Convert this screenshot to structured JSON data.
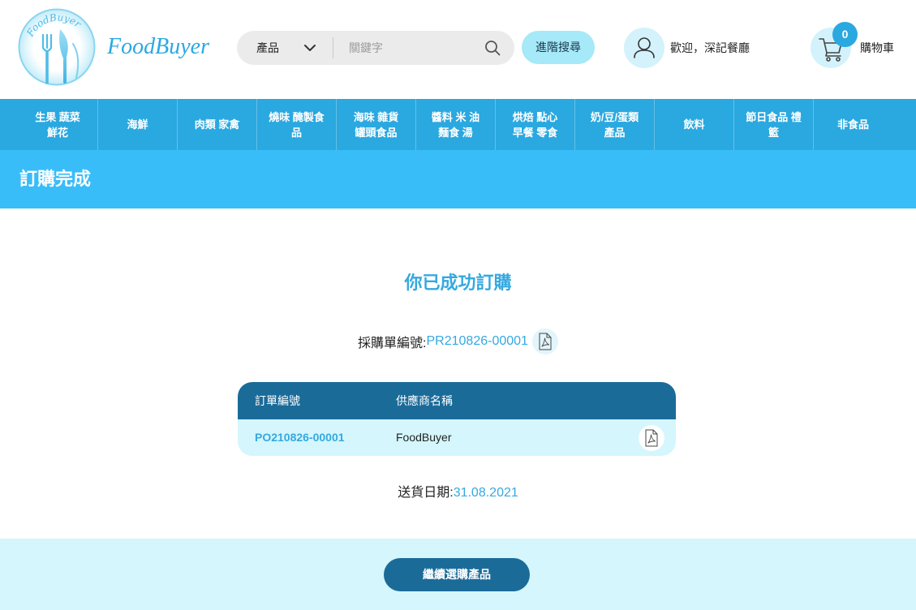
{
  "colors": {
    "nav_bg": "#2aa8e0",
    "banner_bg": "#38bdf8",
    "accent": "#35a9e0",
    "dark": "#1b6b99",
    "light": "#d4f6fc",
    "icon_bg": "#d3f2fb",
    "advanced_bg": "#a6e9f8"
  },
  "icons": {
    "logo": "fork-knife-logo-icon",
    "category_dropdown": "chevron-down-icon",
    "search": "search-icon",
    "user": "user-icon",
    "cart": "cart-icon",
    "document": "pdf-icon"
  },
  "header": {
    "logo": {
      "badge_text": "FoodBuyer",
      "wordmark": "FoodBuyer"
    },
    "search": {
      "category_selected": "產品",
      "placeholder": "關鍵字",
      "advanced_label": "進階搜尋"
    },
    "user": {
      "greeting": "歡迎，深記餐廳"
    },
    "cart": {
      "count": "0",
      "label": "購物車"
    }
  },
  "nav": {
    "items": [
      {
        "lines": [
          "生果 蔬菜",
          "鮮花"
        ]
      },
      {
        "lines": [
          "海鮮"
        ]
      },
      {
        "lines": [
          "肉類 家禽"
        ]
      },
      {
        "lines": [
          "燒味 醃製食",
          "品"
        ]
      },
      {
        "lines": [
          "海味 雜貨",
          "罐頭食品"
        ]
      },
      {
        "lines": [
          "醬料 米 油",
          "麵食 湯"
        ]
      },
      {
        "lines": [
          "烘焙 點心",
          "早餐 零食"
        ]
      },
      {
        "lines": [
          "奶/豆/蛋類",
          "產品"
        ]
      },
      {
        "lines": [
          "飲料"
        ]
      },
      {
        "lines": [
          "節日食品 禮",
          "籃"
        ]
      },
      {
        "lines": [
          "非食品"
        ]
      }
    ]
  },
  "page": {
    "title": "訂購完成"
  },
  "confirmation": {
    "heading": "你已成功訂購",
    "pr_label": "採購單編號:",
    "pr_number": "PR210826-00001",
    "table": {
      "headers": {
        "order_no": "訂單編號",
        "supplier": "供應商名稱"
      },
      "rows": [
        {
          "order_no": "PO210826-00001",
          "supplier": "FoodBuyer"
        }
      ]
    },
    "delivery_label": "送貨日期:",
    "delivery_date": "31.08.2021"
  },
  "footer": {
    "continue_label": "繼續選購產品"
  }
}
